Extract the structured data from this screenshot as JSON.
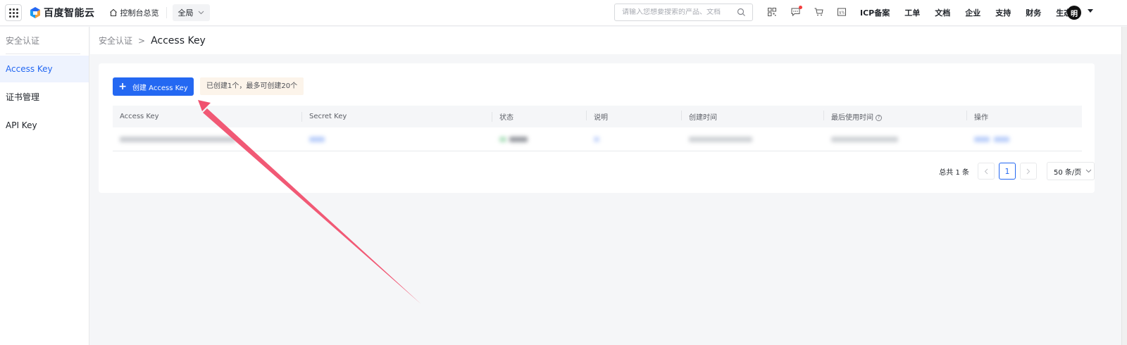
{
  "topbar": {
    "brand": "百度智能云",
    "home_label": "控制台总览",
    "region": "全局",
    "search_placeholder": "请输入您想要搜索的产品、文档",
    "icons": [
      "qrcode-icon",
      "message-icon",
      "cart-icon",
      "billing-icon"
    ],
    "links": [
      "ICP备案",
      "工单",
      "文档",
      "企业",
      "支持",
      "财务",
      "生态"
    ],
    "avatar_initial": "明"
  },
  "sidebar": {
    "title": "安全认证",
    "items": [
      {
        "label": "Access Key",
        "active": true
      },
      {
        "label": "证书管理",
        "active": false
      },
      {
        "label": "API Key",
        "active": false
      }
    ]
  },
  "breadcrumb": {
    "parent": "安全认证",
    "separator": ">",
    "current": "Access Key"
  },
  "main": {
    "create_button": "创建 Access Key",
    "quota_note": "已创建1个，最多可创建20个",
    "table": {
      "columns": [
        "Access Key",
        "Secret Key",
        "状态",
        "说明",
        "创建时间",
        "最后使用时间",
        "操作"
      ]
    },
    "pagination": {
      "total": "总共 1 条",
      "current_page": "1",
      "page_size": "50 条/页"
    }
  },
  "colors": {
    "accent": "#2468f2",
    "annotation_arrow": "#f0506e",
    "quota_bg": "#fcf4ea"
  }
}
